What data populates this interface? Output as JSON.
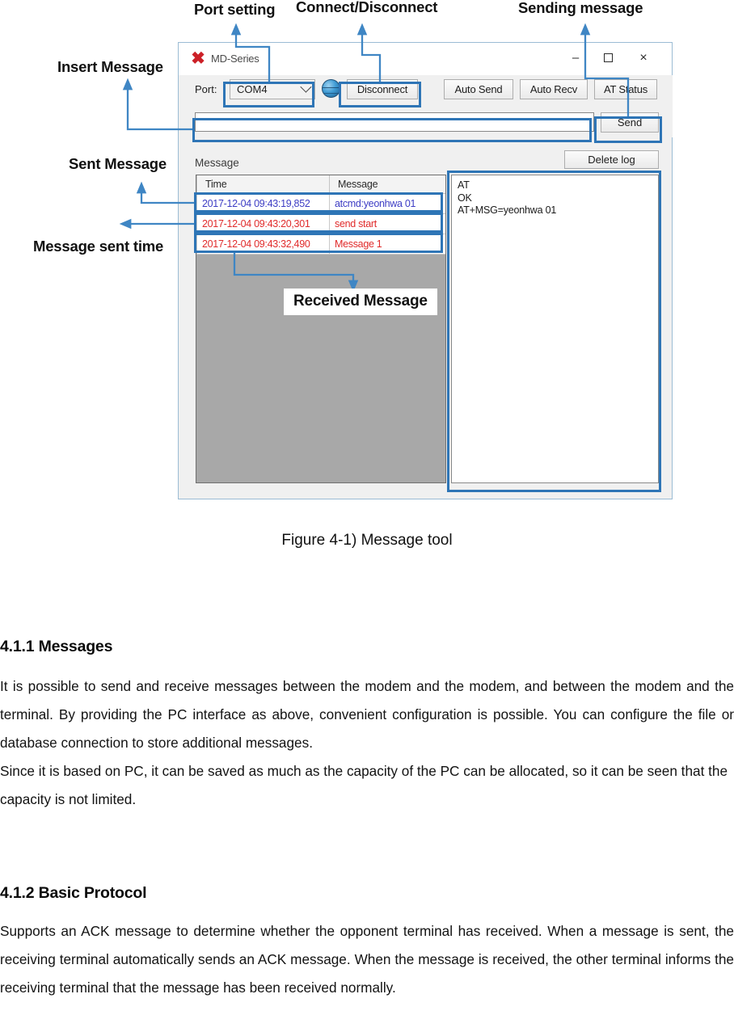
{
  "figure": {
    "caption": "Figure 4-1) Message tool",
    "annotations": {
      "port_setting": "Port setting",
      "connect_disconnect": "Connect/Disconnect",
      "sending_message": "Sending message",
      "insert_message": "Insert Message",
      "sent_message": "Sent Message",
      "message_sent_time": "Message sent time",
      "received_message": "Received Message"
    },
    "accent_color": "#2e75b6"
  },
  "app": {
    "title": "MD-Series",
    "logo_icon": "x-logo-icon",
    "window_controls": {
      "minimize": "–",
      "maximize": "maximize-icon",
      "close": "×"
    },
    "toolbar": {
      "port_label": "Port:",
      "port_value": "COM4",
      "port_options": [
        "COM4"
      ],
      "globe_icon": "globe-icon",
      "disconnect_label": "Disconnect",
      "auto_send_label": "Auto Send",
      "auto_recv_label": "Auto Recv",
      "at_status_label": "AT Status"
    },
    "send_row": {
      "input_value": "",
      "input_placeholder": "",
      "send_label": "Send"
    },
    "message_section": {
      "label": "Message",
      "delete_log_label": "Delete log",
      "table": {
        "columns": [
          "Time",
          "Message"
        ],
        "rows": [
          {
            "time": "2017-12-04 09:43:19,852",
            "message": "atcmd:yeonhwa 01",
            "color": "#3d3dc4"
          },
          {
            "time": "2017-12-04 09:43:20,301",
            "message": "send start",
            "color": "#e02b2b"
          },
          {
            "time": "2017-12-04 09:43:32,490",
            "message": "Message 1",
            "color": "#e02b2b"
          }
        ]
      },
      "at_console": "AT\nOK\nAT+MSG=yeonhwa 01"
    }
  },
  "document": {
    "sections": [
      {
        "heading": "4.1.1 Messages",
        "paragraph_1": "It is possible to send and receive messages between the modem and the modem, and between the modem and the terminal. By providing the PC interface as above, convenient configuration is possible. You can configure the file or database connection to store additional messages.",
        "paragraph_2": "Since it is based on PC, it can be saved as much as the capacity of the PC can be allocated, so it can be seen that the capacity is not limited."
      },
      {
        "heading": "4.1.2 Basic Protocol",
        "paragraph_1": "Supports an ACK message to determine whether the opponent terminal has received. When a message is sent, the receiving terminal automatically sends an ACK message. When the message is received, the other terminal informs the receiving terminal that the message has been received normally."
      }
    ]
  }
}
